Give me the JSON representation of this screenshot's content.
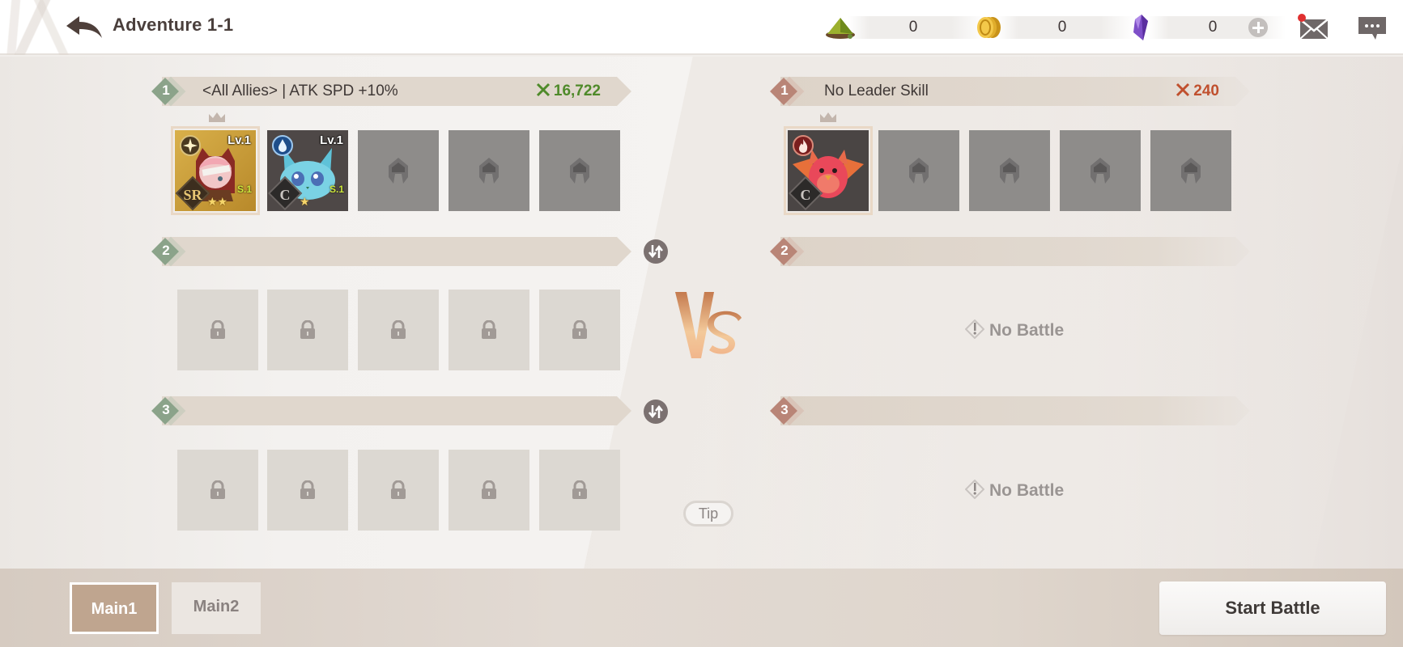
{
  "header": {
    "title": "Adventure 1-1",
    "back_icon": "back-arrow-icon",
    "currencies": [
      {
        "name": "stamina",
        "icon": "stamina-pyramid-icon",
        "value": "0"
      },
      {
        "name": "gold",
        "icon": "gold-coin-icon",
        "value": "0"
      },
      {
        "name": "gems",
        "icon": "purple-crystal-icon",
        "value": "0"
      }
    ],
    "add_currency_icon": "plus-icon",
    "mail_icon": "mail-icon",
    "mail_has_notification": true,
    "chat_icon": "chat-icon"
  },
  "allies": {
    "sections": [
      {
        "number": "1",
        "leader_skill": "<All Allies> | ATK SPD +10%",
        "power": "16,722",
        "slots": [
          {
            "type": "hero",
            "leader": true,
            "level": "Lv.1",
            "rarity": "SR",
            "element": "light",
            "skill_level": "S.1",
            "stars": "★★"
          },
          {
            "type": "hero",
            "leader": false,
            "level": "Lv.1",
            "rarity": "C",
            "element": "water",
            "skill_level": "S.1",
            "stars": "★"
          },
          {
            "type": "empty"
          },
          {
            "type": "empty"
          },
          {
            "type": "empty"
          }
        ]
      },
      {
        "number": "2",
        "slots": [
          {
            "type": "locked"
          },
          {
            "type": "locked"
          },
          {
            "type": "locked"
          },
          {
            "type": "locked"
          },
          {
            "type": "locked"
          }
        ]
      },
      {
        "number": "3",
        "slots": [
          {
            "type": "locked"
          },
          {
            "type": "locked"
          },
          {
            "type": "locked"
          },
          {
            "type": "locked"
          },
          {
            "type": "locked"
          }
        ]
      }
    ]
  },
  "enemies": {
    "sections": [
      {
        "number": "1",
        "leader_skill": "No Leader Skill",
        "power": "240",
        "slots": [
          {
            "type": "hero",
            "leader": true,
            "rarity": "C",
            "element": "fire"
          },
          {
            "type": "empty"
          },
          {
            "type": "empty"
          },
          {
            "type": "empty"
          },
          {
            "type": "empty"
          }
        ]
      },
      {
        "number": "2",
        "status": "No Battle"
      },
      {
        "number": "3",
        "status": "No Battle"
      }
    ]
  },
  "vs_label": "VS",
  "tip_label": "Tip",
  "footer": {
    "tabs": [
      {
        "label": "Main1",
        "active": true
      },
      {
        "label": "Main2",
        "active": false
      }
    ],
    "start_battle_label": "Start Battle"
  },
  "colors": {
    "ally_accent": "#8ba38a",
    "enemy_accent": "#b98577",
    "ally_power": "#4f8a2a",
    "enemy_power": "#c0502e",
    "active_tab": "#bfa58f"
  }
}
